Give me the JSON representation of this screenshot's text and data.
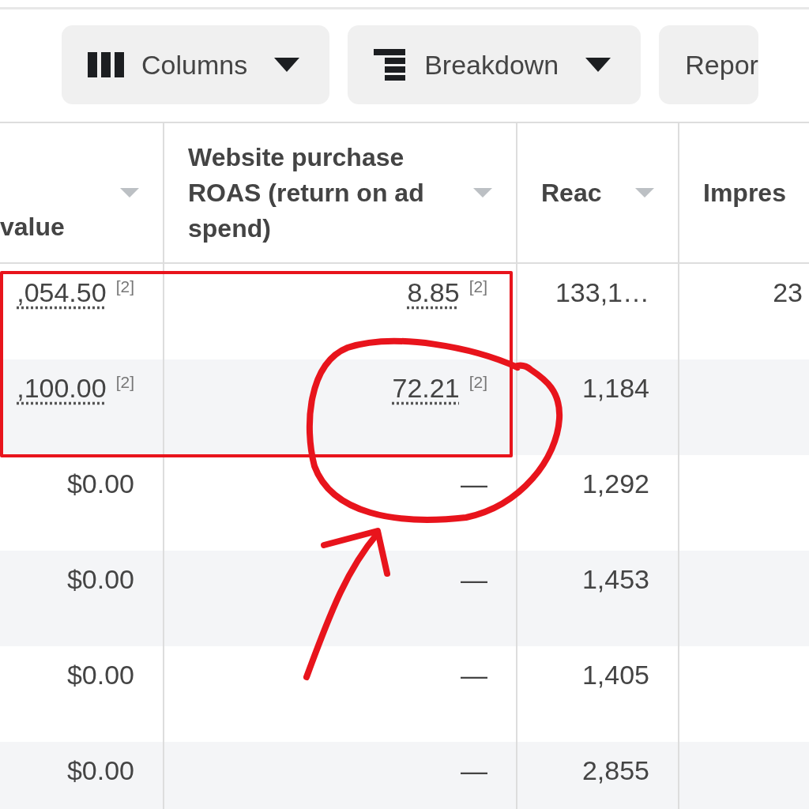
{
  "toolbar": {
    "buttons": [
      {
        "kind": "columns",
        "label": "Columns",
        "dropdown": true
      },
      {
        "kind": "breakdown",
        "label": "Breakdown",
        "dropdown": true
      },
      {
        "kind": "reports",
        "label": "Repor",
        "dropdown": false
      }
    ]
  },
  "table": {
    "columns": [
      {
        "label": "value",
        "sort_caret": true
      },
      {
        "label": "Website purchase ROAS (return on ad spend)",
        "sort_caret": true
      },
      {
        "label": "Reac",
        "sort_caret": true
      },
      {
        "label": "Impres",
        "sort_caret": false
      }
    ],
    "rows": [
      {
        "cells": [
          {
            "text": ",054.50",
            "footnote": "[2]"
          },
          {
            "text": "8.85",
            "footnote": "[2]"
          },
          {
            "text": "133,1…"
          },
          {
            "text": "23"
          }
        ]
      },
      {
        "cells": [
          {
            "text": ",100.00",
            "footnote": "[2]"
          },
          {
            "text": "72.21",
            "footnote": "[2]"
          },
          {
            "text": "1,184"
          },
          {
            "text": ""
          }
        ]
      },
      {
        "cells": [
          {
            "text": "$0.00"
          },
          {
            "text": "—"
          },
          {
            "text": "1,292"
          },
          {
            "text": ""
          }
        ]
      },
      {
        "cells": [
          {
            "text": "$0.00"
          },
          {
            "text": "—"
          },
          {
            "text": "1,453"
          },
          {
            "text": ""
          }
        ]
      },
      {
        "cells": [
          {
            "text": "$0.00"
          },
          {
            "text": "—"
          },
          {
            "text": "1,405"
          },
          {
            "text": ""
          }
        ]
      },
      {
        "cells": [
          {
            "text": "$0.00"
          },
          {
            "text": "—"
          },
          {
            "text": "2,855"
          },
          {
            "text": ""
          }
        ]
      }
    ]
  },
  "annotations": [
    {
      "kind": "rectangle"
    },
    {
      "kind": "circle"
    },
    {
      "kind": "arrow"
    }
  ]
}
